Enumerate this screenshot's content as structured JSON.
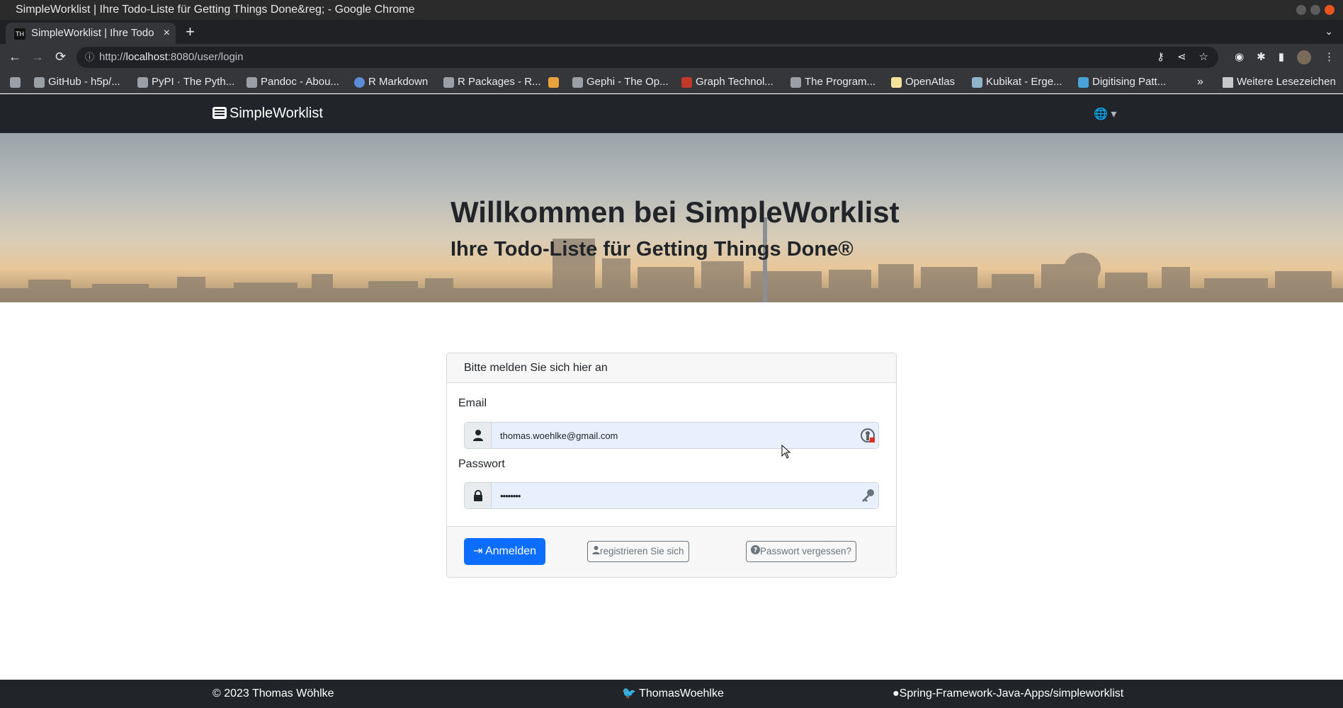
{
  "window": {
    "title": "SimpleWorklist | Ihre Todo-Liste für Getting Things Done&reg; - Google Chrome"
  },
  "tab": {
    "label": "SimpleWorklist | Ihre Todo",
    "favicon_text": "TH",
    "close_icon": "×",
    "new_tab_icon": "+"
  },
  "toolbar": {
    "back_icon": "←",
    "forward_icon": "→",
    "reload_icon": "⟳",
    "url_scheme": "http://",
    "url_host": "localhost",
    "url_rest": ":8080/user/login"
  },
  "bookmarks": {
    "items": [
      {
        "label": ""
      },
      {
        "label": "GitHub - h5p/..."
      },
      {
        "label": "PyPI · The Pyth..."
      },
      {
        "label": "Pandoc - Abou..."
      },
      {
        "label": "R Markdown"
      },
      {
        "label": "R Packages - R..."
      },
      {
        "label": ""
      },
      {
        "label": "Gephi - The Op..."
      },
      {
        "label": "Graph Technol..."
      },
      {
        "label": "The Program..."
      },
      {
        "label": "OpenAtlas"
      },
      {
        "label": "Kubikat - Erge..."
      },
      {
        "label": "Digitising Patt..."
      }
    ],
    "more_icon": "»",
    "other_label": "Weitere Lesezeichen"
  },
  "navbar": {
    "brand": "SimpleWorklist",
    "language_icon": "globe-icon",
    "language_glyph": "🌐 ▾"
  },
  "hero": {
    "title": "Willkommen bei SimpleWorklist",
    "subtitle": "Ihre Todo-Liste für Getting Things Done®"
  },
  "login": {
    "header": "Bitte melden Sie sich hier an",
    "email_label": "Email",
    "email_value": "thomas.woehlke@gmail.com",
    "password_label": "Passwort",
    "password_value": "••••••••",
    "submit_label": "Anmelden",
    "register_label": "registrieren Sie sich",
    "forgot_label": "Passwort vergessen?"
  },
  "footer": {
    "copyright": "© 2023 Thomas Wöhlke",
    "twitter": "ThomasWoehlke",
    "github": "Spring-Framework-Java-Apps/simpleworklist"
  },
  "colors": {
    "primary": "#0d6efd",
    "navbar": "#212529",
    "autofill": "#e8f0fe"
  }
}
